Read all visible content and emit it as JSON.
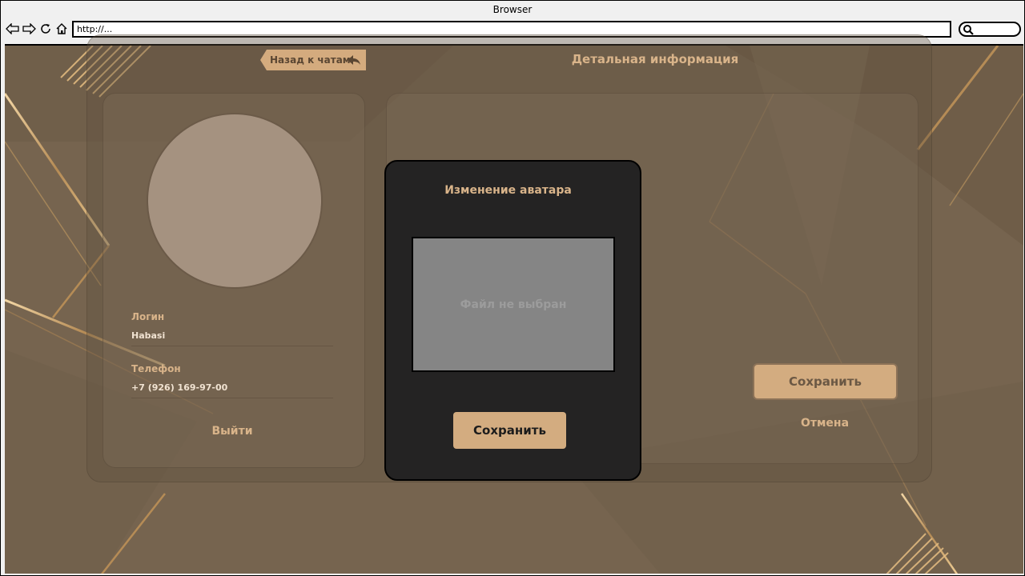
{
  "browser": {
    "title": "Browser",
    "url": "http://..."
  },
  "header": {
    "back_label": "Назад к чатам",
    "title": "Детальная информация"
  },
  "profile": {
    "login_label": "Логин",
    "login_value": "Habasi",
    "phone_label": "Телефон",
    "phone_value": "+7 (926) 169-97-00",
    "logout_label": "Выйти"
  },
  "details": {
    "save_label": "Сохранить",
    "cancel_label": "Отмена"
  },
  "avatar_modal": {
    "title": "Изменение аватара",
    "file_placeholder": "Файл не выбран",
    "save_label": "Сохранить"
  },
  "colors": {
    "background": "#76644f",
    "accent": "#d4ab7e",
    "modal": "#242323"
  }
}
